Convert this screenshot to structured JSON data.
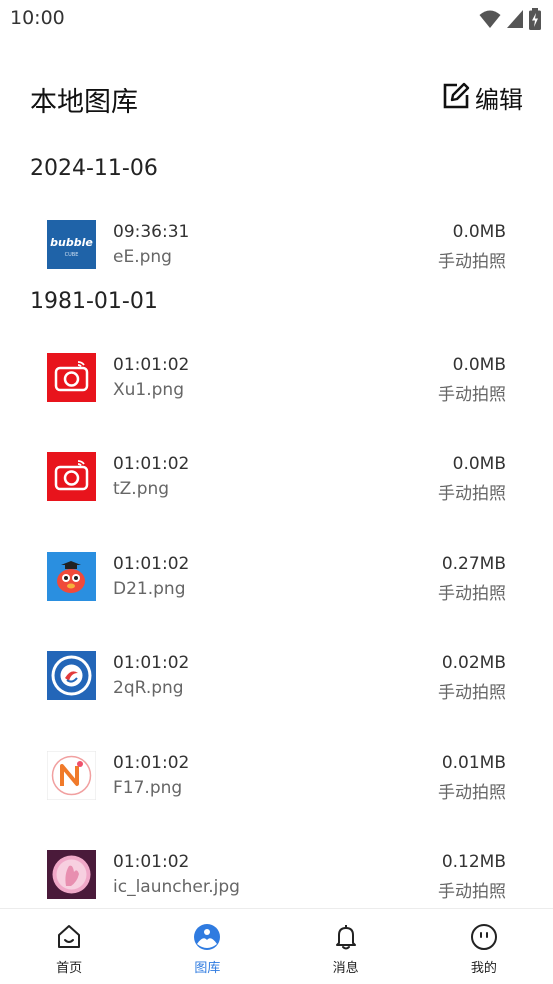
{
  "status_bar": {
    "time": "10:00",
    "icons": [
      "wifi-icon",
      "signal-icon",
      "battery-charging-icon"
    ]
  },
  "header": {
    "title": "本地图库",
    "edit_label": "编辑"
  },
  "groups": [
    {
      "date": "2024-11-06",
      "items": [
        {
          "time": "09:36:31",
          "name": "eE.png",
          "size": "0.0MB",
          "source": "手动拍照",
          "icon": "bubble-cube-app-icon"
        }
      ]
    },
    {
      "date": "1981-01-01",
      "items": [
        {
          "time": "01:01:02",
          "name": "Xu1.png",
          "size": "0.0MB",
          "source": "手动拍照",
          "icon": "red-camera-app-icon"
        },
        {
          "time": "01:01:02",
          "name": "tZ.png",
          "size": "0.0MB",
          "source": "手动拍照",
          "icon": "red-camera-app-icon"
        },
        {
          "time": "01:01:02",
          "name": "D21.png",
          "size": "0.27MB",
          "source": "手动拍照",
          "icon": "cartoon-fish-app-icon"
        },
        {
          "time": "01:01:02",
          "name": "2qR.png",
          "size": "0.02MB",
          "source": "手动拍照",
          "icon": "school-badge-app-icon"
        },
        {
          "time": "01:01:02",
          "name": "F17.png",
          "size": "0.01MB",
          "source": "手动拍照",
          "icon": "n-logo-app-icon"
        },
        {
          "time": "01:01:02",
          "name": "ic_launcher.jpg",
          "size": "0.12MB",
          "source": "手动拍照",
          "icon": "purple-hand-app-icon"
        }
      ]
    }
  ],
  "bottom_nav": [
    {
      "label": "首页",
      "icon": "home-icon",
      "active": false
    },
    {
      "label": "图库",
      "icon": "gallery-icon",
      "active": true
    },
    {
      "label": "消息",
      "icon": "bell-icon",
      "active": false
    },
    {
      "label": "我的",
      "icon": "profile-icon",
      "active": false
    }
  ],
  "colors": {
    "accent": "#2f7be0",
    "camera_red": "#e8141c",
    "bubble_blue": "#1f63a8"
  },
  "thumb_text": {
    "bubble_line1": "bubble",
    "bubble_line2": "CUBE"
  }
}
